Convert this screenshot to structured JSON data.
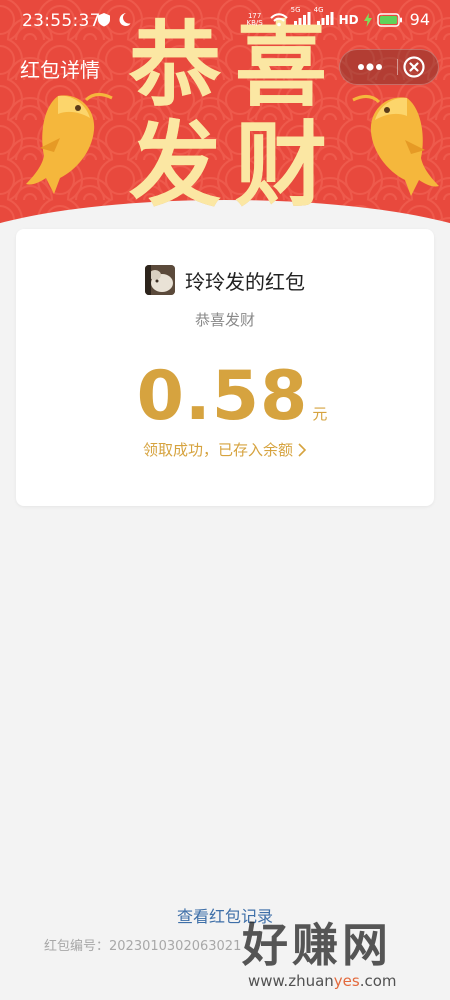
{
  "status_bar": {
    "time": "23:55:37",
    "net_speed_value": "177",
    "net_speed_unit": "KB/S",
    "network_5g": "5G",
    "network_4g": "4G",
    "hd": "HD",
    "battery_level": "94"
  },
  "header": {
    "title": "红包详情",
    "greeting_chars": [
      "恭",
      "喜",
      "发",
      "财"
    ]
  },
  "card": {
    "sender_name": "玲玲发的红包",
    "wish": "恭喜发财",
    "amount": "0.58",
    "unit": "元",
    "status_text": "领取成功，已存入余额"
  },
  "footer": {
    "records_link": "查看红包记录",
    "serial_label": "红包编号：",
    "serial_value": "2023010302063021"
  },
  "watermark": {
    "brand": "好赚网",
    "domain_prefix": "www.zhuan",
    "domain_highlight": "yes",
    "domain_suffix": ".com"
  },
  "colors": {
    "header_red": "#e8493d",
    "gold": "#d6a33f",
    "greeting_gold": "#fbe7a3",
    "link_blue": "#3e6fa8",
    "background": "#f3f3f3"
  }
}
